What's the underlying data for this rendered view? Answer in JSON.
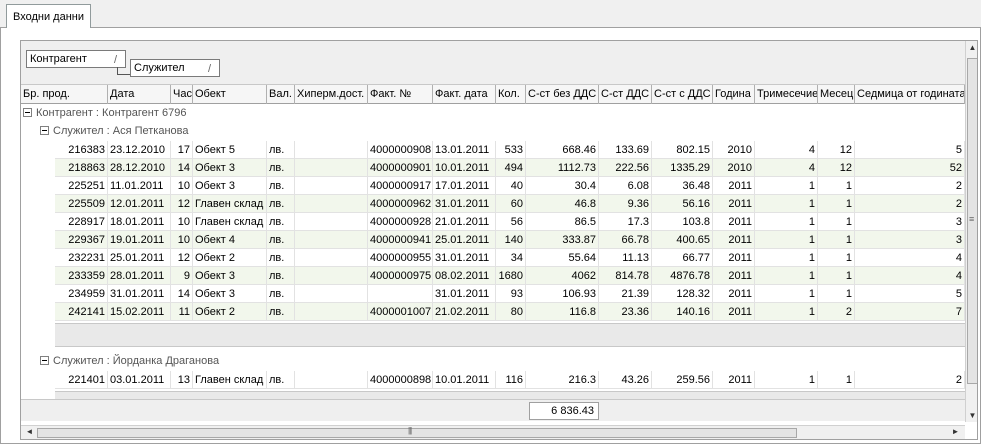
{
  "tab": {
    "label": "Входни данни"
  },
  "group_panel": {
    "groups": [
      "Контрагент",
      "Служител"
    ]
  },
  "columns": [
    "Бр. прод.",
    "Дата",
    "Час",
    "Обект",
    "Вал.",
    "Хиперм.дост.",
    "Факт. №",
    "Факт. дата",
    "Кол.",
    "С-ст без ДДС",
    "С-ст ДДС",
    "С-ст с ДДС",
    "Година",
    "Тримесечие",
    "Месец",
    "Седмица от годината"
  ],
  "groups": [
    {
      "label": "Контрагент : Контрагент 6796",
      "subgroups": [
        {
          "label": "Служител : Ася Петканова",
          "rows": [
            [
              "216383",
              "23.12.2010",
              "17",
              "Обект 5",
              "лв.",
              "",
              "4000000908",
              "13.01.2011",
              "533",
              "668.46",
              "133.69",
              "802.15",
              "2010",
              "4",
              "12",
              "5"
            ],
            [
              "218863",
              "28.12.2010",
              "14",
              "Обект 3",
              "лв.",
              "",
              "4000000901",
              "10.01.2011",
              "494",
              "1112.73",
              "222.56",
              "1335.29",
              "2010",
              "4",
              "12",
              "52"
            ],
            [
              "225251",
              "11.01.2011",
              "10",
              "Обект 3",
              "лв.",
              "",
              "4000000917",
              "17.01.2011",
              "40",
              "30.4",
              "6.08",
              "36.48",
              "2011",
              "1",
              "1",
              "2"
            ],
            [
              "225509",
              "12.01.2011",
              "12",
              "Главен склад",
              "лв.",
              "",
              "4000000962",
              "31.01.2011",
              "60",
              "46.8",
              "9.36",
              "56.16",
              "2011",
              "1",
              "1",
              "2"
            ],
            [
              "228917",
              "18.01.2011",
              "10",
              "Главен склад",
              "лв.",
              "",
              "4000000928",
              "21.01.2011",
              "56",
              "86.5",
              "17.3",
              "103.8",
              "2011",
              "1",
              "1",
              "3"
            ],
            [
              "229367",
              "19.01.2011",
              "10",
              "Обект 4",
              "лв.",
              "",
              "4000000941",
              "25.01.2011",
              "140",
              "333.87",
              "66.78",
              "400.65",
              "2011",
              "1",
              "1",
              "3"
            ],
            [
              "232231",
              "25.01.2011",
              "12",
              "Обект 2",
              "лв.",
              "",
              "4000000955",
              "31.01.2011",
              "34",
              "55.64",
              "11.13",
              "66.77",
              "2011",
              "1",
              "1",
              "4"
            ],
            [
              "233359",
              "28.01.2011",
              "9",
              "Обект 3",
              "лв.",
              "",
              "4000000975",
              "08.02.2011",
              "1680",
              "4062",
              "814.78",
              "4876.78",
              "2011",
              "1",
              "1",
              "4"
            ],
            [
              "234959",
              "31.01.2011",
              "14",
              "Обект 3",
              "лв.",
              "",
              "",
              "31.01.2011",
              "93",
              "106.93",
              "21.39",
              "128.32",
              "2011",
              "1",
              "1",
              "5"
            ],
            [
              "242141",
              "15.02.2011",
              "11",
              "Обект 2",
              "лв.",
              "",
              "4000001007",
              "21.02.2011",
              "80",
              "116.8",
              "23.36",
              "140.16",
              "2011",
              "1",
              "2",
              "7"
            ]
          ]
        },
        {
          "label": "Служител : Йорданка Драганова",
          "rows": [
            [
              "221401",
              "03.01.2011",
              "13",
              "Главен склад",
              "лв.",
              "",
              "4000000898",
              "10.01.2011",
              "116",
              "216.3",
              "43.26",
              "259.56",
              "2011",
              "1",
              "1",
              "2"
            ]
          ]
        }
      ]
    }
  ],
  "total": {
    "value": "6 836.43"
  }
}
